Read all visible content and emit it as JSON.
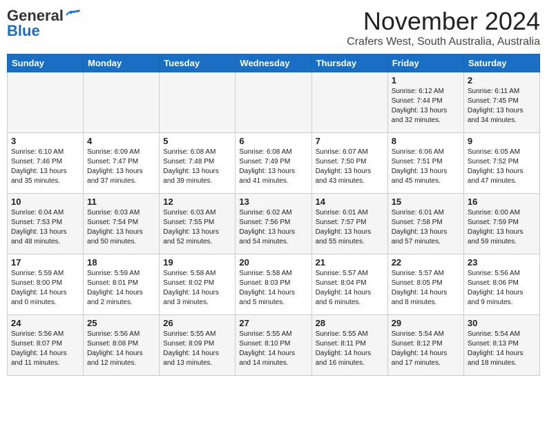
{
  "header": {
    "logo_general": "General",
    "logo_blue": "Blue",
    "month_title": "November 2024",
    "subtitle": "Crafers West, South Australia, Australia"
  },
  "weekdays": [
    "Sunday",
    "Monday",
    "Tuesday",
    "Wednesday",
    "Thursday",
    "Friday",
    "Saturday"
  ],
  "weeks": [
    [
      {
        "day": "",
        "info": ""
      },
      {
        "day": "",
        "info": ""
      },
      {
        "day": "",
        "info": ""
      },
      {
        "day": "",
        "info": ""
      },
      {
        "day": "",
        "info": ""
      },
      {
        "day": "1",
        "info": "Sunrise: 6:12 AM\nSunset: 7:44 PM\nDaylight: 13 hours and 32 minutes."
      },
      {
        "day": "2",
        "info": "Sunrise: 6:11 AM\nSunset: 7:45 PM\nDaylight: 13 hours and 34 minutes."
      }
    ],
    [
      {
        "day": "3",
        "info": "Sunrise: 6:10 AM\nSunset: 7:46 PM\nDaylight: 13 hours and 35 minutes."
      },
      {
        "day": "4",
        "info": "Sunrise: 6:09 AM\nSunset: 7:47 PM\nDaylight: 13 hours and 37 minutes."
      },
      {
        "day": "5",
        "info": "Sunrise: 6:08 AM\nSunset: 7:48 PM\nDaylight: 13 hours and 39 minutes."
      },
      {
        "day": "6",
        "info": "Sunrise: 6:08 AM\nSunset: 7:49 PM\nDaylight: 13 hours and 41 minutes."
      },
      {
        "day": "7",
        "info": "Sunrise: 6:07 AM\nSunset: 7:50 PM\nDaylight: 13 hours and 43 minutes."
      },
      {
        "day": "8",
        "info": "Sunrise: 6:06 AM\nSunset: 7:51 PM\nDaylight: 13 hours and 45 minutes."
      },
      {
        "day": "9",
        "info": "Sunrise: 6:05 AM\nSunset: 7:52 PM\nDaylight: 13 hours and 47 minutes."
      }
    ],
    [
      {
        "day": "10",
        "info": "Sunrise: 6:04 AM\nSunset: 7:53 PM\nDaylight: 13 hours and 48 minutes."
      },
      {
        "day": "11",
        "info": "Sunrise: 6:03 AM\nSunset: 7:54 PM\nDaylight: 13 hours and 50 minutes."
      },
      {
        "day": "12",
        "info": "Sunrise: 6:03 AM\nSunset: 7:55 PM\nDaylight: 13 hours and 52 minutes."
      },
      {
        "day": "13",
        "info": "Sunrise: 6:02 AM\nSunset: 7:56 PM\nDaylight: 13 hours and 54 minutes."
      },
      {
        "day": "14",
        "info": "Sunrise: 6:01 AM\nSunset: 7:57 PM\nDaylight: 13 hours and 55 minutes."
      },
      {
        "day": "15",
        "info": "Sunrise: 6:01 AM\nSunset: 7:58 PM\nDaylight: 13 hours and 57 minutes."
      },
      {
        "day": "16",
        "info": "Sunrise: 6:00 AM\nSunset: 7:59 PM\nDaylight: 13 hours and 59 minutes."
      }
    ],
    [
      {
        "day": "17",
        "info": "Sunrise: 5:59 AM\nSunset: 8:00 PM\nDaylight: 14 hours and 0 minutes."
      },
      {
        "day": "18",
        "info": "Sunrise: 5:59 AM\nSunset: 8:01 PM\nDaylight: 14 hours and 2 minutes."
      },
      {
        "day": "19",
        "info": "Sunrise: 5:58 AM\nSunset: 8:02 PM\nDaylight: 14 hours and 3 minutes."
      },
      {
        "day": "20",
        "info": "Sunrise: 5:58 AM\nSunset: 8:03 PM\nDaylight: 14 hours and 5 minutes."
      },
      {
        "day": "21",
        "info": "Sunrise: 5:57 AM\nSunset: 8:04 PM\nDaylight: 14 hours and 6 minutes."
      },
      {
        "day": "22",
        "info": "Sunrise: 5:57 AM\nSunset: 8:05 PM\nDaylight: 14 hours and 8 minutes."
      },
      {
        "day": "23",
        "info": "Sunrise: 5:56 AM\nSunset: 8:06 PM\nDaylight: 14 hours and 9 minutes."
      }
    ],
    [
      {
        "day": "24",
        "info": "Sunrise: 5:56 AM\nSunset: 8:07 PM\nDaylight: 14 hours and 11 minutes."
      },
      {
        "day": "25",
        "info": "Sunrise: 5:56 AM\nSunset: 8:08 PM\nDaylight: 14 hours and 12 minutes."
      },
      {
        "day": "26",
        "info": "Sunrise: 5:55 AM\nSunset: 8:09 PM\nDaylight: 14 hours and 13 minutes."
      },
      {
        "day": "27",
        "info": "Sunrise: 5:55 AM\nSunset: 8:10 PM\nDaylight: 14 hours and 14 minutes."
      },
      {
        "day": "28",
        "info": "Sunrise: 5:55 AM\nSunset: 8:11 PM\nDaylight: 14 hours and 16 minutes."
      },
      {
        "day": "29",
        "info": "Sunrise: 5:54 AM\nSunset: 8:12 PM\nDaylight: 14 hours and 17 minutes."
      },
      {
        "day": "30",
        "info": "Sunrise: 5:54 AM\nSunset: 8:13 PM\nDaylight: 14 hours and 18 minutes."
      }
    ]
  ]
}
